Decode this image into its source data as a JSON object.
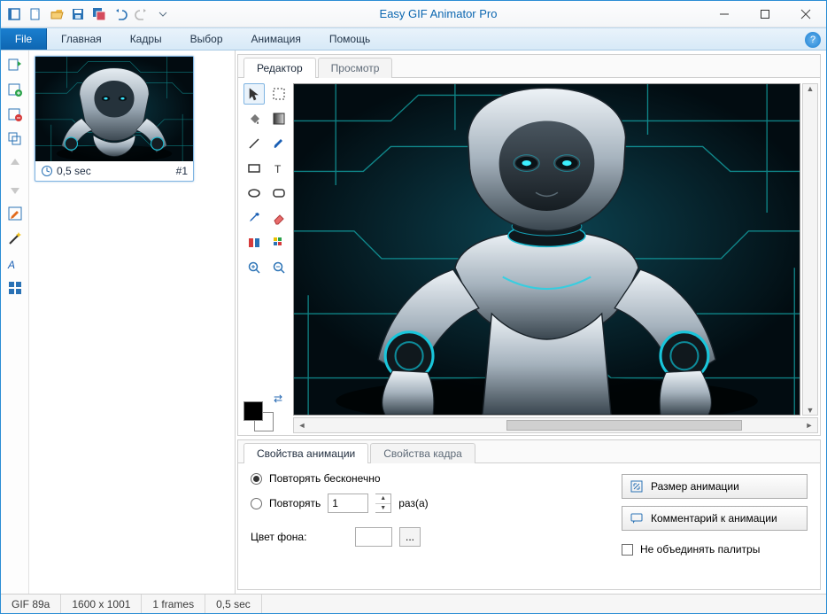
{
  "app": {
    "title": "Easy GIF Animator Pro"
  },
  "menu": {
    "file": "File",
    "items": [
      "Главная",
      "Кадры",
      "Выбор",
      "Анимация",
      "Помощь"
    ]
  },
  "frame": {
    "duration": "0,5 sec",
    "index": "#1"
  },
  "tabs": {
    "editor": "Редактор",
    "preview": "Просмотр"
  },
  "props": {
    "tabs": {
      "anim": "Свойства анимации",
      "frame": "Свойства кадра"
    },
    "repeat_forever": "Повторять бесконечно",
    "repeat": "Повторять",
    "repeat_count": "1",
    "times_suffix": "раз(а)",
    "bg_color": "Цвет фона:",
    "ellipsis": "...",
    "btn_size": "Размер анимации",
    "btn_comment": "Комментарий к анимации",
    "no_merge": "Не объединять палитры"
  },
  "status": {
    "format": "GIF 89a",
    "dims": "1600 x 1001",
    "frames": "1 frames",
    "time": "0,5 sec"
  }
}
